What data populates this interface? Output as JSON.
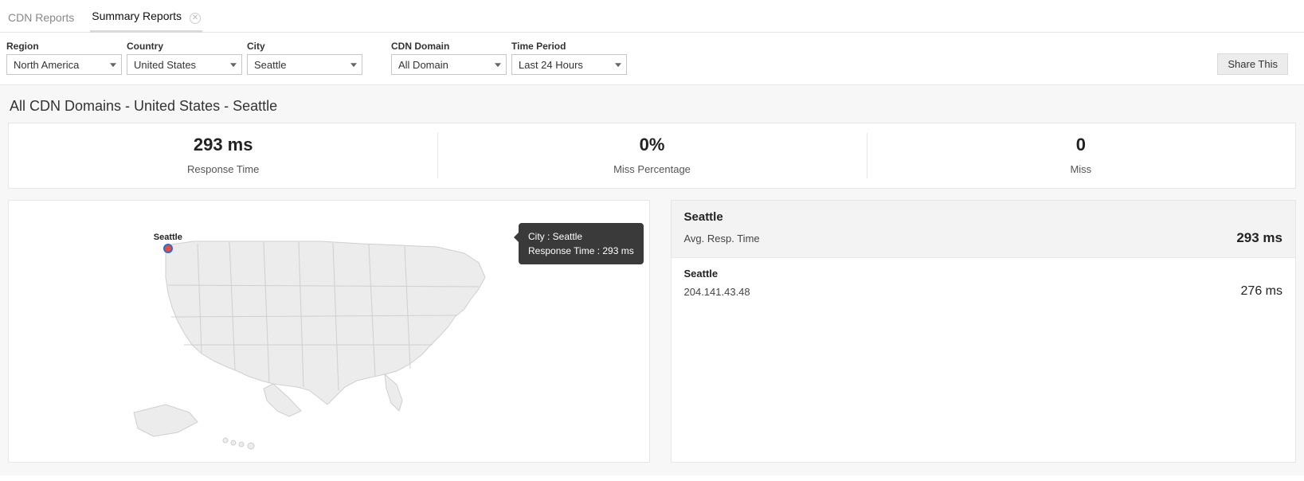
{
  "tabs": {
    "cdn_reports": "CDN Reports",
    "summary_reports": "Summary Reports"
  },
  "filters": {
    "region": {
      "label": "Region",
      "value": "North America"
    },
    "country": {
      "label": "Country",
      "value": "United States"
    },
    "city": {
      "label": "City",
      "value": "Seattle"
    },
    "cdn_domain": {
      "label": "CDN Domain",
      "value": "All Domain"
    },
    "time_period": {
      "label": "Time Period",
      "value": "Last 24 Hours"
    }
  },
  "share_label": "Share This",
  "page_title": "All CDN Domains - United States - Seattle",
  "stats": {
    "response_time": {
      "value": "293 ms",
      "label": "Response Time"
    },
    "miss_percentage": {
      "value": "0%",
      "label": "Miss Percentage"
    },
    "miss": {
      "value": "0",
      "label": "Miss"
    }
  },
  "map": {
    "city_label": "Seattle",
    "tooltip_line1": "City : Seattle",
    "tooltip_line2": "Response Time : 293 ms"
  },
  "side": {
    "header_city": "Seattle",
    "avg_label": "Avg. Resp. Time",
    "avg_value": "293 ms",
    "rows": [
      {
        "title": "Seattle",
        "ip": "204.141.43.48",
        "value": "276 ms"
      }
    ]
  },
  "chart_data": {
    "type": "table",
    "title": "All CDN Domains - United States - Seattle",
    "summary": [
      {
        "metric": "Response Time",
        "value": 293,
        "unit": "ms"
      },
      {
        "metric": "Miss Percentage",
        "value": 0,
        "unit": "%"
      },
      {
        "metric": "Miss",
        "value": 0,
        "unit": ""
      }
    ],
    "city_aggregate": {
      "city": "Seattle",
      "avg_response_time_ms": 293
    },
    "nodes": [
      {
        "city": "Seattle",
        "ip": "204.141.43.48",
        "response_time_ms": 276
      }
    ]
  }
}
